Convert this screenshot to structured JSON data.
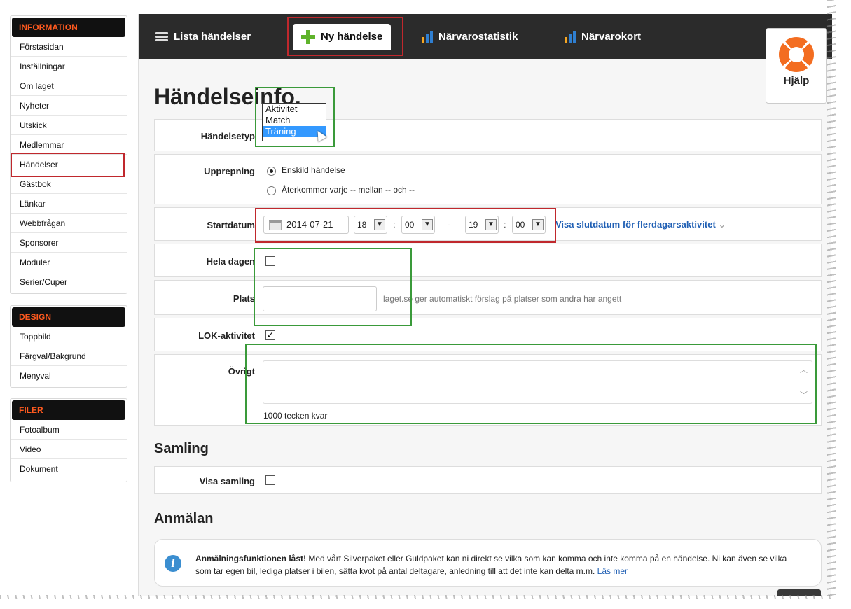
{
  "sidebar": {
    "information": {
      "heading": "INFORMATION",
      "items": [
        "Förstasidan",
        "Inställningar",
        "Om laget",
        "Nyheter",
        "Utskick",
        "Medlemmar",
        "Händelser",
        "Gästbok",
        "Länkar",
        "Webbfrågan",
        "Sponsorer",
        "Moduler",
        "Serier/Cuper"
      ]
    },
    "design": {
      "heading": "DESIGN",
      "items": [
        "Toppbild",
        "Färgval/Bakgrund",
        "Menyval"
      ]
    },
    "filer": {
      "heading": "FILER",
      "items": [
        "Fotoalbum",
        "Video",
        "Dokument"
      ]
    }
  },
  "tabs": {
    "lista": "Lista händelser",
    "ny": "Ny händelse",
    "narvarostatistik": "Närvarostatistik",
    "narvarokort": "Närvarokort"
  },
  "help": {
    "label": "Hjälp"
  },
  "page": {
    "title": "Händelseinfo."
  },
  "form": {
    "handelsetyp": {
      "label": "Händelsetyp",
      "options": [
        "Aktivitet",
        "Match",
        "Träning"
      ],
      "selected": "Träning"
    },
    "upprepning": {
      "label": "Upprepning",
      "option1": "Enskild händelse",
      "option2": "Återkommer varje -- mellan -- och --"
    },
    "startdatum": {
      "label": "Startdatum",
      "date": "2014-07-21",
      "start_hour": "18",
      "start_min": "00",
      "dash": "-",
      "end_hour": "19",
      "end_min": "00",
      "colon": ":",
      "multi_day_link": "Visa slutdatum för flerdagarsaktivitet"
    },
    "hela_dagen": {
      "label": "Hela dagen",
      "checked": false
    },
    "plats": {
      "label": "Plats",
      "value": "",
      "hint": "laget.se ger automatiskt förslag på platser som andra har angett"
    },
    "lok": {
      "label": "LOK-aktivitet",
      "checked": true,
      "check_mark": "✓"
    },
    "ovrigt": {
      "label": "Övrigt",
      "value": "",
      "counter": "1000 tecken kvar"
    }
  },
  "samling": {
    "heading": "Samling",
    "visa_label": "Visa samling",
    "checked": false
  },
  "anmalan": {
    "heading": "Anmälan",
    "info_bold": "Anmälningsfunktionen låst!",
    "info_text": " Med vårt Silverpaket eller Guldpaket kan ni direkt se vilka som kan komma och inte komma på en händelse. Ni kan även se vilka som tar egen bil, lediga platser i bilen, sätta kvot på antal deltagare, anledning till att det inte kan delta m.m. ",
    "info_link": "Läs mer"
  },
  "save_label": "Spara",
  "colors": {
    "sidebar_heading_text": "#ff5a1f",
    "topbar_bg": "#2b2b2b",
    "link": "#1f5fb4",
    "highlight_red": "#c0282d",
    "highlight_green": "#3a9a3a",
    "plus_green": "#5fb32b"
  },
  "icons": {
    "list": "list-icon",
    "plus": "plus-icon",
    "bars": "bar-chart-icon",
    "help": "lifebuoy-icon",
    "calendar": "calendar-icon",
    "info": "info-icon"
  }
}
